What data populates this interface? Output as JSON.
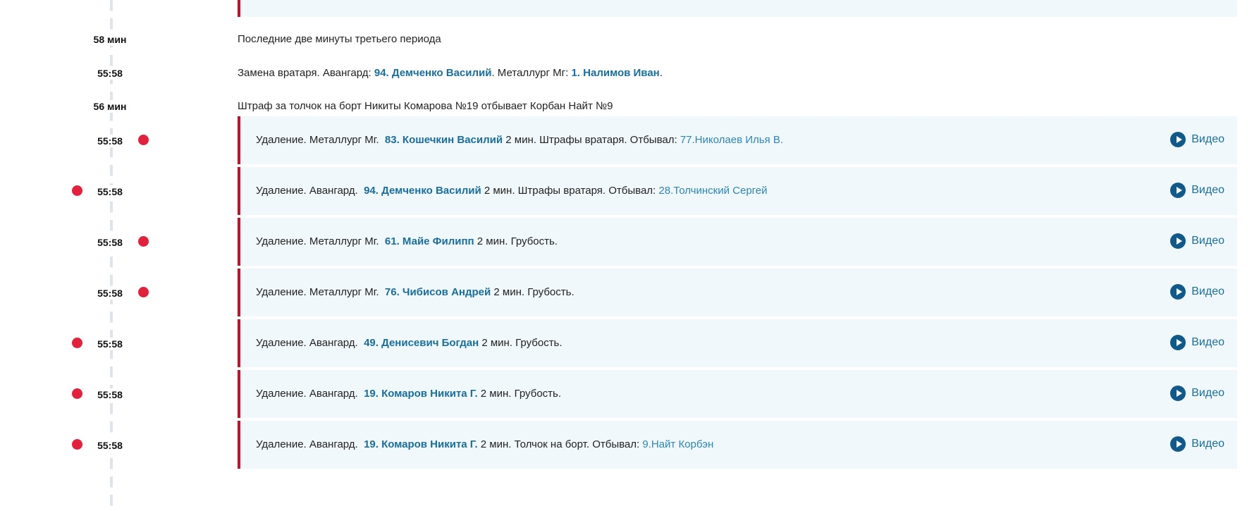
{
  "events": [
    {
      "time": "58 мин",
      "kind": "text",
      "text": "Последние две минуты третьего периода"
    },
    {
      "time": "55:58",
      "kind": "goalie",
      "prefix": "Замена вратаря. Авангард: ",
      "player1": "94. Демченко Василий",
      "mid": ". Металлург Мг: ",
      "player2": "1. Налимов Иван",
      "suffix": "."
    },
    {
      "time": "56 мин",
      "kind": "text",
      "text": "Штраф за толчок на борт Никиты Комарова №19 отбывает Корбан Найт №9"
    },
    {
      "time": "55:58",
      "kind": "penalty",
      "side": "right",
      "team": "Удаление. Металлург Мг.",
      "player": "83. Кошечкин Василий",
      "detail": "2 мин. Штрафы вратаря. Отбывал:",
      "served_by": "77.Николаев Илья В.",
      "video_label": "Видео"
    },
    {
      "time": "55:58",
      "kind": "penalty",
      "side": "left",
      "team": "Удаление. Авангард.",
      "player": "94. Демченко Василий",
      "detail": "2 мин. Штрафы вратаря. Отбывал:",
      "served_by": "28.Толчинский Сергей",
      "video_label": "Видео"
    },
    {
      "time": "55:58",
      "kind": "penalty",
      "side": "right",
      "team": "Удаление. Металлург Мг.",
      "player": "61. Майе Филипп",
      "detail": "2 мин. Грубость.",
      "served_by": "",
      "video_label": "Видео"
    },
    {
      "time": "55:58",
      "kind": "penalty",
      "side": "right",
      "team": "Удаление. Металлург Мг.",
      "player": "76. Чибисов Андрей",
      "detail": "2 мин. Грубость.",
      "served_by": "",
      "video_label": "Видео"
    },
    {
      "time": "55:58",
      "kind": "penalty",
      "side": "left",
      "team": "Удаление. Авангард.",
      "player": "49. Денисевич Богдан",
      "detail": "2 мин. Грубость.",
      "served_by": "",
      "video_label": "Видео"
    },
    {
      "time": "55:58",
      "kind": "penalty",
      "side": "left",
      "team": "Удаление. Авангард.",
      "player": "19. Комаров Никита Г.",
      "detail": "2 мин. Грубость.",
      "served_by": "",
      "video_label": "Видео"
    },
    {
      "time": "55:58",
      "kind": "penalty",
      "side": "left",
      "team": "Удаление. Авангард.",
      "player": "19. Комаров Никита Г.",
      "detail": "2 мин. Толчок на борт. Отбывал:",
      "served_by": "9.Найт Корбэн",
      "video_label": "Видео"
    }
  ],
  "colors": {
    "accent": "#c8102e",
    "dot": "#e4213d",
    "link": "#1a6e9e",
    "card_bg": "#f0f8fc"
  },
  "icons": {
    "video": "play-circle-icon",
    "event_marker": "penalty-dot-icon"
  }
}
